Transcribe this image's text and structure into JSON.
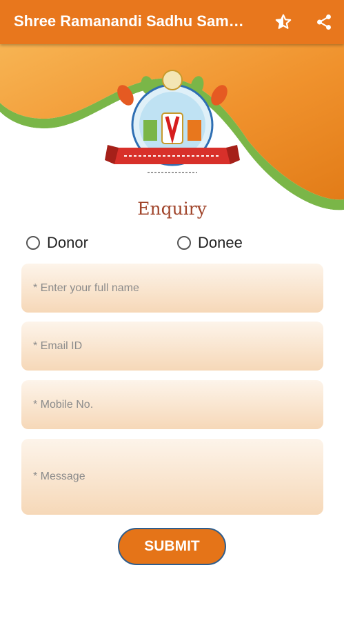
{
  "app_bar": {
    "title": "Shree Ramanandi Sadhu Samaj Seva Trust",
    "icons": [
      "star-half-icon",
      "share-icon"
    ]
  },
  "colors": {
    "primary": "#e8771d",
    "field_bg": "#f6d8b8",
    "title_text": "#a0442a",
    "green_stripe": "#7ab648"
  },
  "form": {
    "title": "Enquiry",
    "radio_options": [
      "Donor",
      "Donee"
    ],
    "fields": {
      "name_placeholder": "* Enter your full name",
      "email_placeholder": "* Email ID",
      "mobile_placeholder": "* Mobile No.",
      "message_placeholder": "* Message"
    },
    "submit_label": "SUBMIT"
  }
}
